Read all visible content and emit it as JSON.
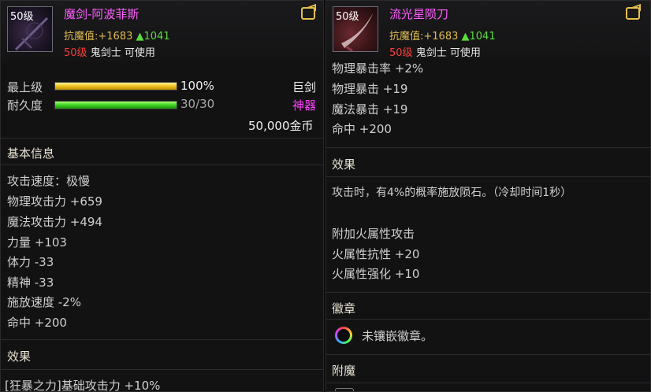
{
  "left": {
    "level": "50级",
    "name": "魔剑-阿波菲斯",
    "resist_label": "抗魔值:",
    "resist_total": "+1683",
    "resist_up": "▲1041",
    "req_level": "50级",
    "req_class": "鬼剑士 可使用",
    "grade_label": "最上级",
    "grade_value": "100%",
    "grade_fraction": 1.0,
    "durability_label": "耐久度",
    "durability_value": "30/30",
    "durability_fraction": 1.0,
    "weapon_type": "巨剑",
    "rarity": "神器",
    "price": "50,000金币",
    "section_basic": "基本信息",
    "stats": [
      "攻击速度：极慢",
      "物理攻击力 +659",
      "魔法攻击力 +494",
      "力量 +103",
      "体力 -33",
      "精神 -33",
      "施放速度 -2%",
      "命中 +200"
    ],
    "section_effect": "效果",
    "effect_line": "[狂暴之力]基础攻击力 +10%"
  },
  "right": {
    "level": "50级",
    "name": "流光星陨刀",
    "resist_label": "抗魔值:",
    "resist_total": "+1683",
    "resist_up": "▲1041",
    "req_level": "50级",
    "req_class": "鬼剑士 可使用",
    "stats": [
      "物理暴击率 +2%",
      "物理暴击 +19",
      "魔法暴击 +19",
      "命中 +200"
    ],
    "section_effect": "效果",
    "effect_text": "攻击时，有4%的概率施放陨石。（冷却时间1秒）",
    "fire_lines": [
      "附加火属性攻击",
      "火属性抗性 +20",
      "火属性强化 +10"
    ],
    "section_emblem": "徽章",
    "emblem_text": "未镶嵌徽章。",
    "section_enchant": "附魔"
  },
  "colors": {
    "name": "#ff5cff",
    "resist": "#e0bb52",
    "up": "#5cdc3c",
    "req_level": "#ff3b3b",
    "rarity": "#ff3bff"
  }
}
